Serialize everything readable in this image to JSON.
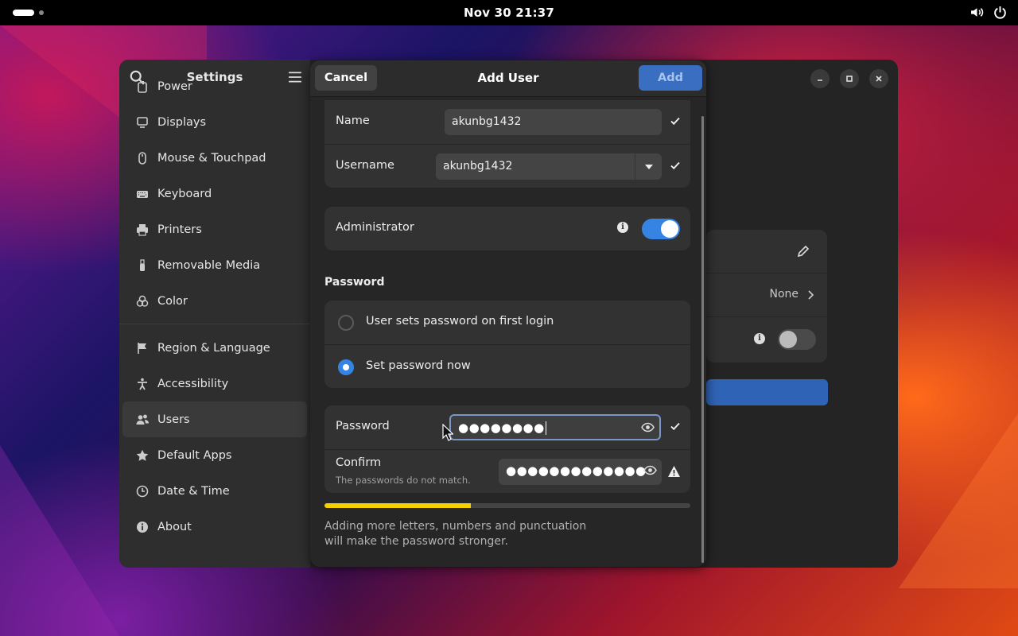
{
  "topbar": {
    "clock": "Nov 30  21:37"
  },
  "settings": {
    "title": "Settings",
    "sidebar": [
      {
        "label": "Power",
        "icon": "power-icon"
      },
      {
        "label": "Displays",
        "icon": "display-icon"
      },
      {
        "label": "Mouse & Touchpad",
        "icon": "mouse-icon"
      },
      {
        "label": "Keyboard",
        "icon": "keyboard-icon"
      },
      {
        "label": "Printers",
        "icon": "printer-icon"
      },
      {
        "label": "Removable Media",
        "icon": "usb-icon"
      },
      {
        "label": "Color",
        "icon": "color-icon"
      },
      {
        "label": "Region & Language",
        "icon": "flag-icon"
      },
      {
        "label": "Accessibility",
        "icon": "accessibility-icon"
      },
      {
        "label": "Users",
        "icon": "users-icon",
        "active": true
      },
      {
        "label": "Default Apps",
        "icon": "star-icon"
      },
      {
        "label": "Date & Time",
        "icon": "clock-icon"
      },
      {
        "label": "About",
        "icon": "info-icon"
      }
    ],
    "background_card": {
      "language_value": "None"
    }
  },
  "dialog": {
    "title": "Add User",
    "cancel_label": "Cancel",
    "add_label": "Add",
    "name": {
      "label": "Name",
      "value": "akunbg1432"
    },
    "username": {
      "label": "Username",
      "value": "akunbg1432"
    },
    "administrator": {
      "label": "Administrator",
      "enabled": true
    },
    "password_section": {
      "title": "Password",
      "options": [
        {
          "label": "User sets password on first login",
          "selected": false
        },
        {
          "label": "Set password now",
          "selected": true
        }
      ],
      "password": {
        "label": "Password",
        "masked": "●●●●●●●●"
      },
      "confirm": {
        "label": "Confirm",
        "masked": "●●●●●●●●●●●●●",
        "error": "The passwords do not match."
      },
      "strength_fraction": 0.4,
      "hint": "Adding more letters, numbers and punctuation will make the password stronger."
    }
  },
  "colors": {
    "accent": "#3584e4",
    "strength": "#f5d000"
  }
}
